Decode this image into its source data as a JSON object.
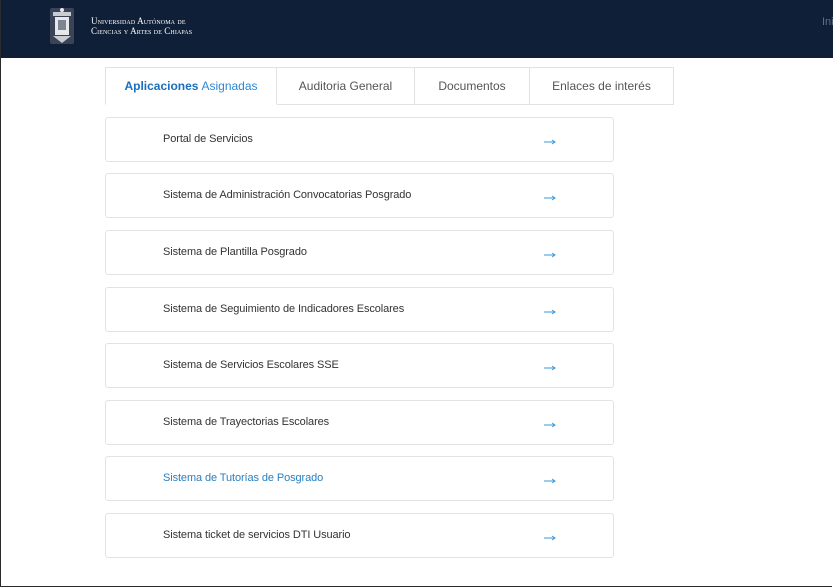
{
  "header": {
    "org_line1": "Universidad Autónoma de",
    "org_line2": "Ciencias y Artes de Chiapas",
    "right_text": "Ini"
  },
  "tabs": [
    {
      "label_strong": "Aplicaciones",
      "label_soft": "Asignadas",
      "active": true
    },
    {
      "label": "Auditoria General"
    },
    {
      "label": "Documentos"
    },
    {
      "label": "Enlaces de interés"
    }
  ],
  "apps": [
    {
      "label": "Portal de Servicios",
      "icon": "arrow-right-icon"
    },
    {
      "label": "Sistema de Administración Convocatorias Posgrado",
      "icon": "arrow-right-icon"
    },
    {
      "label": "Sistema de Plantilla Posgrado",
      "icon": "arrow-right-icon"
    },
    {
      "label": "Sistema de Seguimiento de Indicadores Escolares",
      "icon": "arrow-right-icon"
    },
    {
      "label": "Sistema de Servicios Escolares SSE",
      "icon": "arrow-right-icon"
    },
    {
      "label": "Sistema de Trayectorias Escolares",
      "icon": "arrow-right-icon"
    },
    {
      "label": "Sistema de Tutorías de Posgrado",
      "icon": "arrow-right-icon",
      "highlighted": true
    },
    {
      "label": "Sistema ticket de servicios DTI Usuario",
      "icon": "arrow-right-icon"
    }
  ],
  "colors": {
    "header_bg": "#0f1f37",
    "accent": "#1a6fc0",
    "link": "#2a7fbf",
    "arrow": "#3a9ad9"
  }
}
